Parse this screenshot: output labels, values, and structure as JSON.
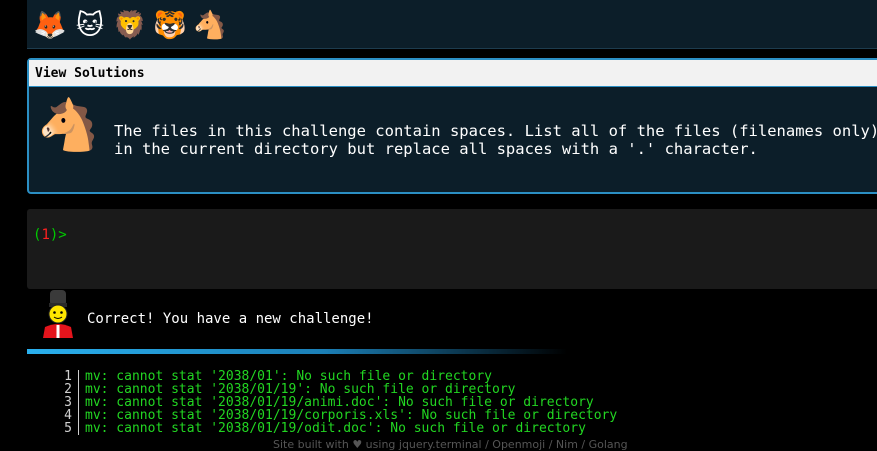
{
  "emoji_bar": {
    "items": [
      {
        "name": "fox",
        "glyph": "🦊"
      },
      {
        "name": "cat",
        "glyph": "🐱"
      },
      {
        "name": "lion",
        "glyph": "🦁"
      },
      {
        "name": "tiger",
        "glyph": "🐯"
      },
      {
        "name": "horse",
        "glyph": "🐴"
      }
    ]
  },
  "panel": {
    "header": "View Solutions",
    "avatar_glyph": "🐴",
    "challenge_text": "The files in this challenge contain spaces. List all of the files (filenames only)\nin the current directory but replace all spaces with a '.' character."
  },
  "terminal": {
    "prompt_open": "(",
    "prompt_number": "1",
    "prompt_close": ")>"
  },
  "feedback": {
    "icon": "guard-icon",
    "text": "Correct! You have a new challenge!"
  },
  "output": {
    "lines": [
      {
        "no": "1",
        "text": "mv: cannot stat '2038/01': No such file or directory"
      },
      {
        "no": "2",
        "text": "mv: cannot stat '2038/01/19': No such file or directory"
      },
      {
        "no": "3",
        "text": "mv: cannot stat '2038/01/19/animi.doc': No such file or directory"
      },
      {
        "no": "4",
        "text": "mv: cannot stat '2038/01/19/corporis.xls': No such file or directory"
      },
      {
        "no": "5",
        "text": "mv: cannot stat '2038/01/19/odit.doc': No such file or directory"
      }
    ]
  },
  "footer": {
    "text": "Site built with ♥ using jquery.terminal / Openmoji / Nim / Golang"
  },
  "colors": {
    "accent": "#2b8fc4",
    "output_green": "#22d622",
    "prompt_green": "#00cc00",
    "prompt_red": "#ff2020"
  }
}
